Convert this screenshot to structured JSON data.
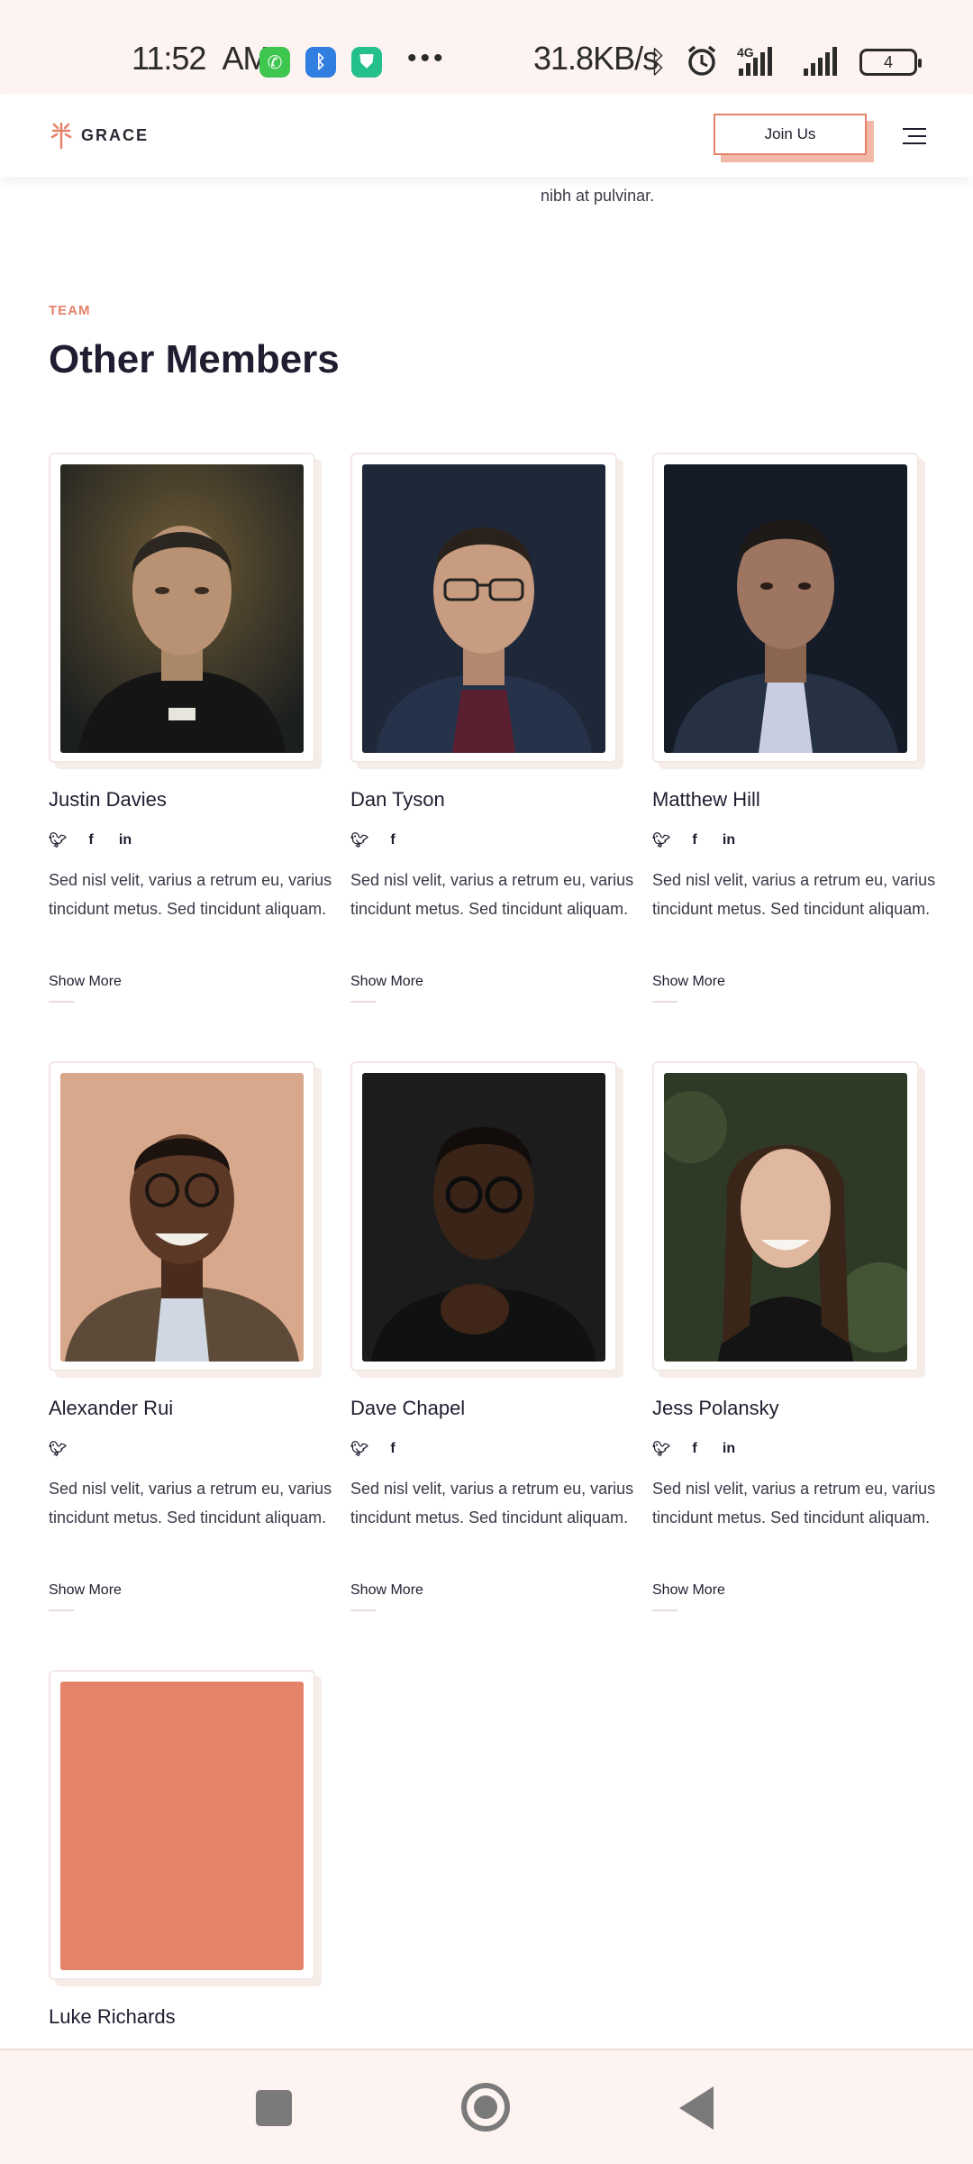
{
  "status_bar": {
    "time": "11:52",
    "ampm": "AM",
    "speed": "31.8KB/s",
    "network": "4G",
    "battery": "4"
  },
  "header": {
    "logo_text": "GRACE",
    "join_label": "Join Us"
  },
  "prev_section": {
    "text": "nibh at pulvinar."
  },
  "team": {
    "eyebrow": "TEAM",
    "title": "Other Members",
    "members": [
      {
        "name": "Justin Davies",
        "socials": [
          "twitter",
          "facebook",
          "linkedin"
        ],
        "bio": "Sed nisl velit, varius a retrum eu, varius tincidunt metus. Sed tincidunt aliquam.",
        "more": "Show More"
      },
      {
        "name": "Dan Tyson",
        "socials": [
          "twitter",
          "facebook"
        ],
        "bio": "Sed nisl velit, varius a retrum eu, varius tincidunt metus. Sed tincidunt aliquam.",
        "more": "Show More"
      },
      {
        "name": "Matthew Hill",
        "socials": [
          "twitter",
          "facebook",
          "linkedin"
        ],
        "bio": "Sed nisl velit, varius a retrum eu, varius tincidunt metus. Sed tincidunt aliquam.",
        "more": "Show More"
      },
      {
        "name": "Alexander Rui",
        "socials": [
          "twitter"
        ],
        "bio": "Sed nisl velit, varius a retrum eu, varius tincidunt metus. Sed tincidunt aliquam.",
        "more": "Show More"
      },
      {
        "name": "Dave Chapel",
        "socials": [
          "twitter",
          "facebook"
        ],
        "bio": "Sed nisl velit, varius a retrum eu, varius tincidunt metus. Sed tincidunt aliquam.",
        "more": "Show More"
      },
      {
        "name": "Jess Polansky",
        "socials": [
          "twitter",
          "facebook",
          "linkedin"
        ],
        "bio": "Sed nisl velit, varius a retrum eu, varius tincidunt metus. Sed tincidunt aliquam.",
        "more": "Show More"
      },
      {
        "name": "Luke Richards"
      }
    ]
  },
  "colors": {
    "accent": "#e5826a",
    "heading": "#1f1e31",
    "statusbar_bg": "#fdf3f1",
    "placeholder_photo": "#e5826a"
  },
  "icons": {
    "menu": "hamburger-icon",
    "twitter": "twitter-icon",
    "facebook": "facebook-icon",
    "linkedin": "linkedin-icon"
  }
}
